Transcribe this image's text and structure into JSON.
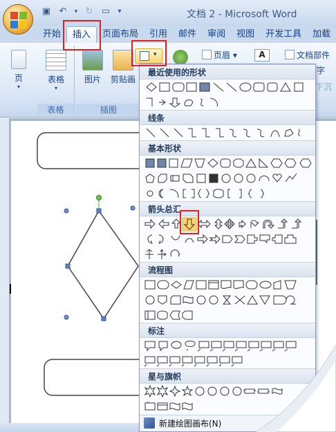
{
  "window": {
    "title": "文档 2 - Microsoft Word"
  },
  "quick_access": [
    "save-icon",
    "undo-icon",
    "redo-icon",
    "new-doc-icon",
    "customize-icon"
  ],
  "tabs": [
    {
      "label": "开始"
    },
    {
      "label": "插入",
      "active": true
    },
    {
      "label": "页面布局"
    },
    {
      "label": "引用"
    },
    {
      "label": "邮件"
    },
    {
      "label": "审阅"
    },
    {
      "label": "视图"
    },
    {
      "label": "开发工具"
    },
    {
      "label": "加载"
    }
  ],
  "ribbon": {
    "pages_label": "页",
    "table_label": "表格",
    "table_group": "表格",
    "picture_label": "图片",
    "clipart_label": "剪贴画",
    "illustrations_group": "插图",
    "header_label": "页眉",
    "textbox_label": "A",
    "docparts_label": "文档部件",
    "wordart_tail": "字",
    "dropcap_tail": "下沉"
  },
  "shapes_menu": {
    "sections": [
      {
        "title": "最近使用的形状"
      },
      {
        "title": "线条"
      },
      {
        "title": "基本形状"
      },
      {
        "title": "箭头总汇"
      },
      {
        "title": "流程图"
      },
      {
        "title": "标注"
      },
      {
        "title": "星与旗帜"
      }
    ],
    "footer": "新建绘图画布(N)"
  },
  "colors": {
    "highlight_red": "#e02020",
    "ribbon_blue": "#15428b",
    "selected_shape": "#ffd66b"
  }
}
